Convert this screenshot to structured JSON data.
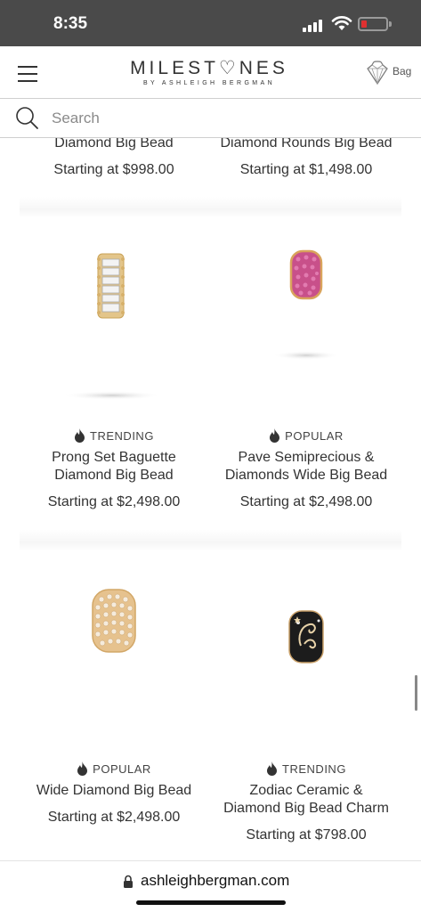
{
  "status_bar": {
    "time": "8:35",
    "battery_color": "#e03030"
  },
  "header": {
    "logo_main": "MILEST♡NES",
    "logo_sub": "BY ASHLEIGH BERGMAN",
    "bag_label": "Bag"
  },
  "search": {
    "placeholder": "Search",
    "value": ""
  },
  "products": {
    "row0": [
      {
        "name": "Diamond Big Bead",
        "price": "Starting at $998.00"
      },
      {
        "name": "Diamond Rounds Big Bead",
        "price": "Starting at $1,498.00"
      }
    ],
    "row1": [
      {
        "badge": "TRENDING",
        "badge_icon": "flame-icon",
        "name_line1": "Prong Set Baguette",
        "name_line2": "Diamond Big Bead",
        "price": "Starting at $2,498.00"
      },
      {
        "badge": "POPULAR",
        "badge_icon": "flame-icon",
        "name_line1": "Pave Semiprecious &",
        "name_line2": "Diamonds Wide Big Bead",
        "price": "Starting at $2,498.00"
      }
    ],
    "row2": [
      {
        "badge": "POPULAR",
        "badge_icon": "flame-icon",
        "name_line1": "Wide Diamond Big Bead",
        "price": "Starting at $2,498.00"
      },
      {
        "badge": "TRENDING",
        "badge_icon": "flame-icon",
        "name_line1": "Zodiac Ceramic &",
        "name_line2": "Diamond Big Bead Charm",
        "price": "Starting at $798.00"
      }
    ]
  },
  "browser": {
    "url": "ashleighbergman.com"
  }
}
